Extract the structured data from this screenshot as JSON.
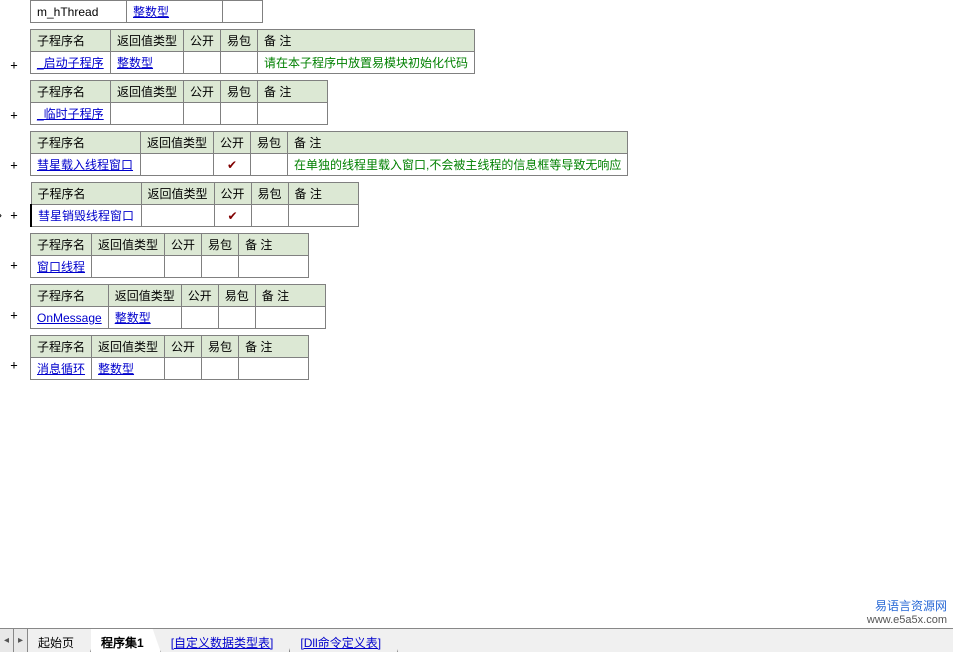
{
  "headers": {
    "subName": "子程序名",
    "returnType": "返回值类型",
    "public": "公开",
    "pkg": "易包",
    "remark": "备 注"
  },
  "topRow": {
    "name": "m_hThread",
    "type": "整数型"
  },
  "procedures": [
    {
      "id": "p1",
      "name": "_启动子程序",
      "returnType": "整数型",
      "public": "",
      "pkg": "",
      "remark": "请在本子程序中放置易模块初始化代码",
      "remarkClass": "remark-green",
      "cols": {
        "name": 80,
        "ret": 60,
        "pub": 32,
        "pkg": 34,
        "rem": 210
      },
      "plusTop": 58
    },
    {
      "id": "p2",
      "name": "_临时子程序",
      "returnType": "",
      "public": "",
      "pkg": "",
      "remark": "",
      "cols": {
        "name": 80,
        "ret": 60,
        "pub": 32,
        "pkg": 34,
        "rem": 70
      },
      "plusTop": 108
    },
    {
      "id": "p3",
      "name": "彗星载入线程窗口",
      "returnType": "",
      "public": "✔",
      "pkg": "",
      "remark": "在单独的线程里载入窗口,不会被主线程的信息框等导致无响应",
      "remarkClass": "remark-green",
      "cols": {
        "name": 110,
        "ret": 60,
        "pub": 32,
        "pkg": 34,
        "rem": 340
      },
      "plusTop": 158
    },
    {
      "id": "p4",
      "name": "彗星销毁线程窗口",
      "nameEditing": true,
      "returnType": "",
      "public": "✔",
      "pkg": "",
      "remark": "",
      "cols": {
        "name": 110,
        "ret": 60,
        "pub": 32,
        "pkg": 34,
        "rem": 70
      },
      "plusTop": 208,
      "special": true
    },
    {
      "id": "p5",
      "name": "窗口线程",
      "returnType": "",
      "public": "",
      "pkg": "",
      "remark": "",
      "cols": {
        "name": 60,
        "ret": 66,
        "pub": 32,
        "pkg": 34,
        "rem": 70
      },
      "plusTop": 258
    },
    {
      "id": "p6",
      "name": "OnMessage",
      "returnType": "整数型",
      "public": "",
      "pkg": "",
      "remark": "",
      "cols": {
        "name": 60,
        "ret": 66,
        "pub": 32,
        "pkg": 34,
        "rem": 70
      },
      "plusTop": 308
    },
    {
      "id": "p7",
      "name": "消息循环",
      "returnType": "整数型",
      "public": "",
      "pkg": "",
      "remark": "",
      "cols": {
        "name": 60,
        "ret": 66,
        "pub": 32,
        "pkg": 34,
        "rem": 70
      },
      "plusTop": 358
    }
  ],
  "tabs": {
    "scrollLeft": "◂",
    "scrollRight": "▸",
    "items": [
      {
        "label": "起始页",
        "active": false,
        "link": false
      },
      {
        "label": "程序集1",
        "active": true,
        "link": false
      },
      {
        "label": "[自定义数据类型表]",
        "active": false,
        "link": true
      },
      {
        "label": "[Dll命令定义表]",
        "active": false,
        "link": true
      }
    ]
  },
  "watermark": {
    "line1": "易语言资源网",
    "line2": "www.e5a5x.com"
  }
}
